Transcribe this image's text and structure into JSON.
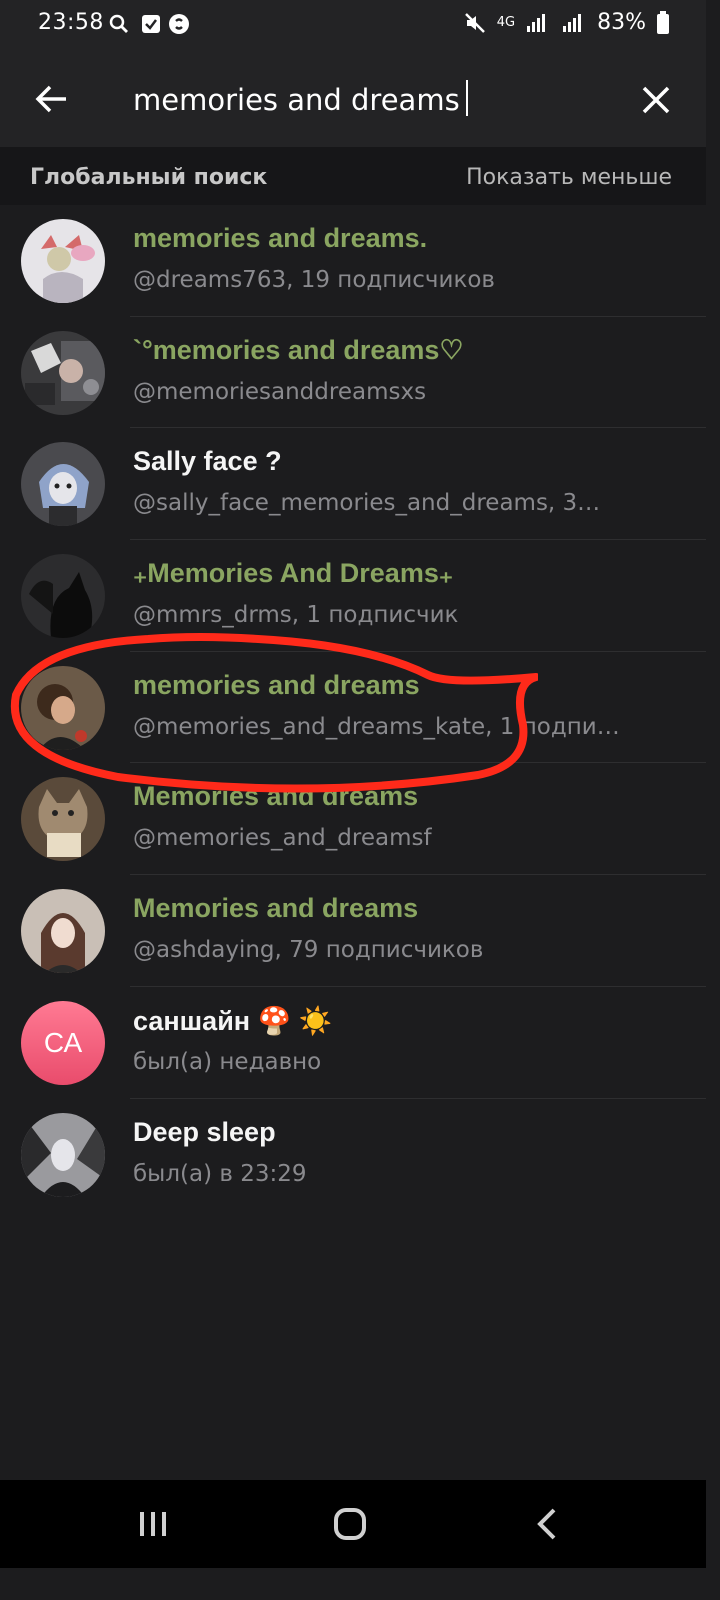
{
  "status_bar": {
    "time": "23:58",
    "network": "4G",
    "battery": "83%",
    "icons": [
      "search-icon",
      "check-square-icon",
      "shazam-icon",
      "mute-icon",
      "signal-icon",
      "battery-icon"
    ]
  },
  "search": {
    "query": "memories and dreams"
  },
  "section": {
    "title": "Глобальный поиск",
    "toggle": "Показать меньше"
  },
  "results": [
    {
      "title": "memories and dreams.",
      "subtitle": "@dreams763, 19 подписчиков",
      "highlight": true
    },
    {
      "title": "`°memories and dreams♡",
      "subtitle": "@memoriesanddreamsxs",
      "highlight": true
    },
    {
      "title": "Sally face ?",
      "subtitle": "@sally_face_memories_and_dreams, 3…",
      "highlight": false
    },
    {
      "title": "₊Memories And Dreams₊",
      "subtitle": "@mmrs_drms, 1 подписчик",
      "highlight": true
    },
    {
      "title": "memories and dreams",
      "subtitle": "@memories_and_dreams_kate, 1 подпи…",
      "highlight": true
    },
    {
      "title": "Memories and dreams",
      "subtitle": "@memories_and_dreamsf",
      "highlight": true
    },
    {
      "title": "Memories and dreams",
      "subtitle": "@ashdaying, 79 подписчиков",
      "highlight": true
    },
    {
      "title": "саншайн 🍄 ☀️",
      "subtitle": "был(а) недавно",
      "highlight": false,
      "avatar_initials": "СА"
    },
    {
      "title": "Deep sleep",
      "subtitle": "был(а) в 23:29",
      "highlight": false
    }
  ],
  "colors": {
    "background": "#1c1c1e",
    "highlight": "#8aa561",
    "annotation": "#ff2a1a"
  }
}
